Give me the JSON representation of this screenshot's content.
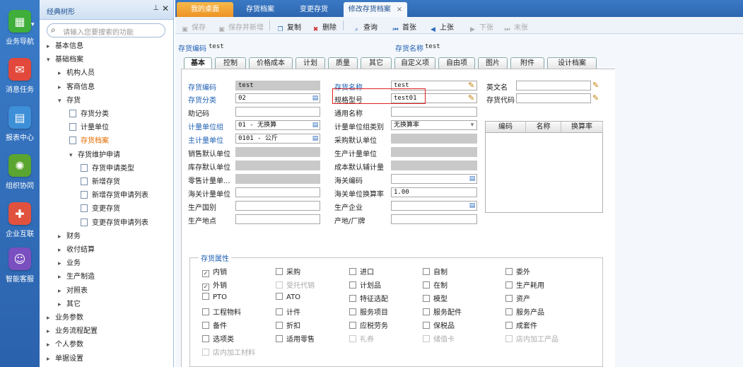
{
  "leftnav": [
    {
      "label": "业务导航",
      "icon": "business-nav-icon",
      "color": "#3fae3a",
      "glyph": "▦"
    },
    {
      "label": "消息任务",
      "icon": "message-task-icon",
      "color": "#e2493c",
      "glyph": "✉"
    },
    {
      "label": "报表中心",
      "icon": "report-center-icon",
      "color": "#3d8fd8",
      "glyph": "▤"
    },
    {
      "label": "组织协同",
      "icon": "org-collab-icon",
      "color": "#5aa52f",
      "glyph": "✺"
    },
    {
      "label": "企业互联",
      "icon": "enterprise-link-icon",
      "color": "#e0523e",
      "glyph": "✚"
    },
    {
      "label": "智能客服",
      "icon": "smart-service-icon",
      "color": "#7a4fc0",
      "glyph": "☺"
    }
  ],
  "tree": {
    "title": "经典树形",
    "search_placeholder": "请输入您要搜索的功能",
    "nodes": [
      {
        "label": "基本信息",
        "level": 0,
        "arrow": "›",
        "type": "folder"
      },
      {
        "label": "基础档案",
        "level": 0,
        "arrow": "⌄",
        "type": "folder"
      },
      {
        "label": "机构人员",
        "level": 1,
        "arrow": "›",
        "type": "folder"
      },
      {
        "label": "客商信息",
        "level": 1,
        "arrow": "›",
        "type": "folder"
      },
      {
        "label": "存货",
        "level": 1,
        "arrow": "⌄",
        "type": "folder"
      },
      {
        "label": "存货分类",
        "level": 2,
        "arrow": "",
        "type": "doc"
      },
      {
        "label": "计量单位",
        "level": 2,
        "arrow": "",
        "type": "doc"
      },
      {
        "label": "存货档案",
        "level": 2,
        "arrow": "",
        "type": "doc",
        "active": true
      },
      {
        "label": "存货维护申请",
        "level": 2,
        "arrow": "⌄",
        "type": "folder"
      },
      {
        "label": "存货申请类型",
        "level": 3,
        "arrow": "",
        "type": "doc"
      },
      {
        "label": "新增存货",
        "level": 3,
        "arrow": "",
        "type": "doc"
      },
      {
        "label": "新增存货申请列表",
        "level": 3,
        "arrow": "",
        "type": "doc"
      },
      {
        "label": "变更存货",
        "level": 3,
        "arrow": "",
        "type": "doc"
      },
      {
        "label": "变更存货申请列表",
        "level": 3,
        "arrow": "",
        "type": "doc"
      },
      {
        "label": "财务",
        "level": 1,
        "arrow": "›",
        "type": "folder"
      },
      {
        "label": "收付结算",
        "level": 1,
        "arrow": "›",
        "type": "folder"
      },
      {
        "label": "业务",
        "level": 1,
        "arrow": "›",
        "type": "folder"
      },
      {
        "label": "生产制造",
        "level": 1,
        "arrow": "›",
        "type": "folder"
      },
      {
        "label": "对照表",
        "level": 1,
        "arrow": "›",
        "type": "folder"
      },
      {
        "label": "其它",
        "level": 1,
        "arrow": "›",
        "type": "folder"
      },
      {
        "label": "业务参数",
        "level": 0,
        "arrow": "›",
        "type": "folder"
      },
      {
        "label": "业务流程配置",
        "level": 0,
        "arrow": "›",
        "type": "folder"
      },
      {
        "label": "个人参数",
        "level": 0,
        "arrow": "›",
        "type": "folder"
      },
      {
        "label": "单据设置",
        "level": 0,
        "arrow": "›",
        "type": "folder"
      }
    ]
  },
  "tabs": [
    {
      "label": "我的桌面",
      "style": "orange"
    },
    {
      "label": "存货档案",
      "style": "normal"
    },
    {
      "label": "变更存货",
      "style": "normal"
    },
    {
      "label": "修改存货档案",
      "style": "active",
      "close": "×"
    }
  ],
  "toolbar": [
    {
      "label": "保存",
      "icon": "save-icon",
      "glyph": "▣",
      "disabled": true
    },
    {
      "label": "保存并新增",
      "icon": "save-new-icon",
      "glyph": "▣",
      "disabled": true
    },
    {
      "label": "复制",
      "icon": "copy-icon",
      "glyph": "❐",
      "disabled": false
    },
    {
      "label": "删除",
      "icon": "delete-icon",
      "glyph": "✖",
      "disabled": false
    },
    {
      "label": "查询",
      "icon": "query-icon",
      "glyph": "⌕",
      "disabled": false
    },
    {
      "label": "首张",
      "icon": "first-icon",
      "glyph": "⏮",
      "disabled": false
    },
    {
      "label": "上张",
      "icon": "prev-icon",
      "glyph": "◀",
      "disabled": false
    },
    {
      "label": "下张",
      "icon": "next-icon",
      "glyph": "▶",
      "disabled": true
    },
    {
      "label": "末张",
      "icon": "last-icon",
      "glyph": "⏭",
      "disabled": true
    }
  ],
  "header": {
    "code_label": "存货编码",
    "code_value": "test",
    "name_label": "存货名称",
    "name_value": "test"
  },
  "subtabs": [
    "基本",
    "控制",
    "价格成本",
    "计划",
    "质量",
    "其它",
    "自定义项",
    "自由项",
    "图片",
    "附件",
    "设计档案"
  ],
  "form": {
    "col1": [
      {
        "label": "存货编码",
        "blue": true,
        "value": "test",
        "gray": true,
        "btn": ""
      },
      {
        "label": "存货分类",
        "blue": true,
        "value": "02",
        "gray": false,
        "btn": "▤"
      },
      {
        "label": "助记码",
        "blue": false,
        "value": "",
        "gray": false,
        "btn": ""
      },
      {
        "label": "计量单位组",
        "blue": true,
        "value": "01 - 无换算",
        "gray": false,
        "btn": "▤"
      },
      {
        "label": "主计量单位",
        "blue": true,
        "value": "0101 - 公斤",
        "gray": false,
        "btn": "▤"
      },
      {
        "label": "销售默认单位",
        "blue": false,
        "value": "",
        "gray": true,
        "btn": ""
      },
      {
        "label": "库存默认单位",
        "blue": false,
        "value": "",
        "gray": true,
        "btn": ""
      },
      {
        "label": "零售计量单...",
        "blue": false,
        "value": "",
        "gray": true,
        "btn": ""
      },
      {
        "label": "海关计量单位",
        "blue": false,
        "value": "",
        "gray": false,
        "btn": ""
      },
      {
        "label": "生产国别",
        "blue": false,
        "value": "",
        "gray": false,
        "btn": ""
      },
      {
        "label": "生产地点",
        "blue": false,
        "value": "",
        "gray": false,
        "btn": ""
      }
    ],
    "col2": [
      {
        "label": "存货名称",
        "blue": true,
        "value": "test",
        "gray": false,
        "btn": "✎"
      },
      {
        "label": "规格型号",
        "blue": false,
        "value": "test01",
        "gray": false,
        "btn": "✎"
      },
      {
        "label": "通用名称",
        "blue": false,
        "value": "",
        "gray": false,
        "btn": ""
      },
      {
        "label": "计量单位组类别",
        "blue": false,
        "value": "无换算率",
        "gray": false,
        "btn": "⌄"
      },
      {
        "label": "采购默认单位",
        "blue": false,
        "value": "",
        "gray": true,
        "btn": ""
      },
      {
        "label": "生产计量单位",
        "blue": false,
        "value": "",
        "gray": true,
        "btn": ""
      },
      {
        "label": "成本默认辅计量",
        "blue": false,
        "value": "",
        "gray": true,
        "btn": ""
      },
      {
        "label": "海关编码",
        "blue": false,
        "value": "",
        "gray": false,
        "btn": "▤"
      },
      {
        "label": "海关单位换算率",
        "blue": false,
        "value": "1.00",
        "gray": false,
        "btn": ""
      },
      {
        "label": "生产企业",
        "blue": false,
        "value": "",
        "gray": false,
        "btn": "▤"
      },
      {
        "label": "产地/厂牌",
        "blue": false,
        "value": "",
        "gray": false,
        "btn": ""
      }
    ],
    "col3": [
      {
        "label": "英文名",
        "value": "",
        "btn": "✎"
      },
      {
        "label": "存货代码",
        "value": "",
        "btn": "✎"
      }
    ],
    "code_table_headers": [
      "编码",
      "名称",
      "换算率"
    ]
  },
  "attributes": {
    "legend": "存货属性",
    "rows": [
      [
        {
          "label": "内销",
          "checked": true
        },
        {
          "label": "采购"
        },
        {
          "label": "进口"
        },
        {
          "label": "自制"
        },
        {
          "label": "委外"
        }
      ],
      [
        {
          "label": "外销",
          "checked": true
        },
        {
          "label": "受托代销",
          "disabled": true
        },
        {
          "label": "计划品"
        },
        {
          "label": "在制"
        },
        {
          "label": "生产耗用"
        }
      ],
      [
        {
          "label": "PTO"
        },
        {
          "label": "ATO"
        },
        {
          "label": "特征选配"
        },
        {
          "label": "模型"
        },
        {
          "label": "资产"
        }
      ],
      [
        {
          "label": "工程物料"
        },
        {
          "label": "计件"
        },
        {
          "label": "服务项目"
        },
        {
          "label": "服务配件"
        },
        {
          "label": "服务产品"
        }
      ],
      [
        {
          "label": "备件"
        },
        {
          "label": "折扣"
        },
        {
          "label": "应税劳务"
        },
        {
          "label": "保税品"
        },
        {
          "label": "成套件"
        }
      ],
      [
        {
          "label": "选项类"
        },
        {
          "label": "适用零售"
        },
        {
          "label": "礼券",
          "disabled": true
        },
        {
          "label": "储值卡",
          "disabled": true
        },
        {
          "label": "店内加工产品",
          "disabled": true
        }
      ],
      [
        {
          "label": "店内加工材料",
          "disabled": true
        }
      ]
    ]
  }
}
